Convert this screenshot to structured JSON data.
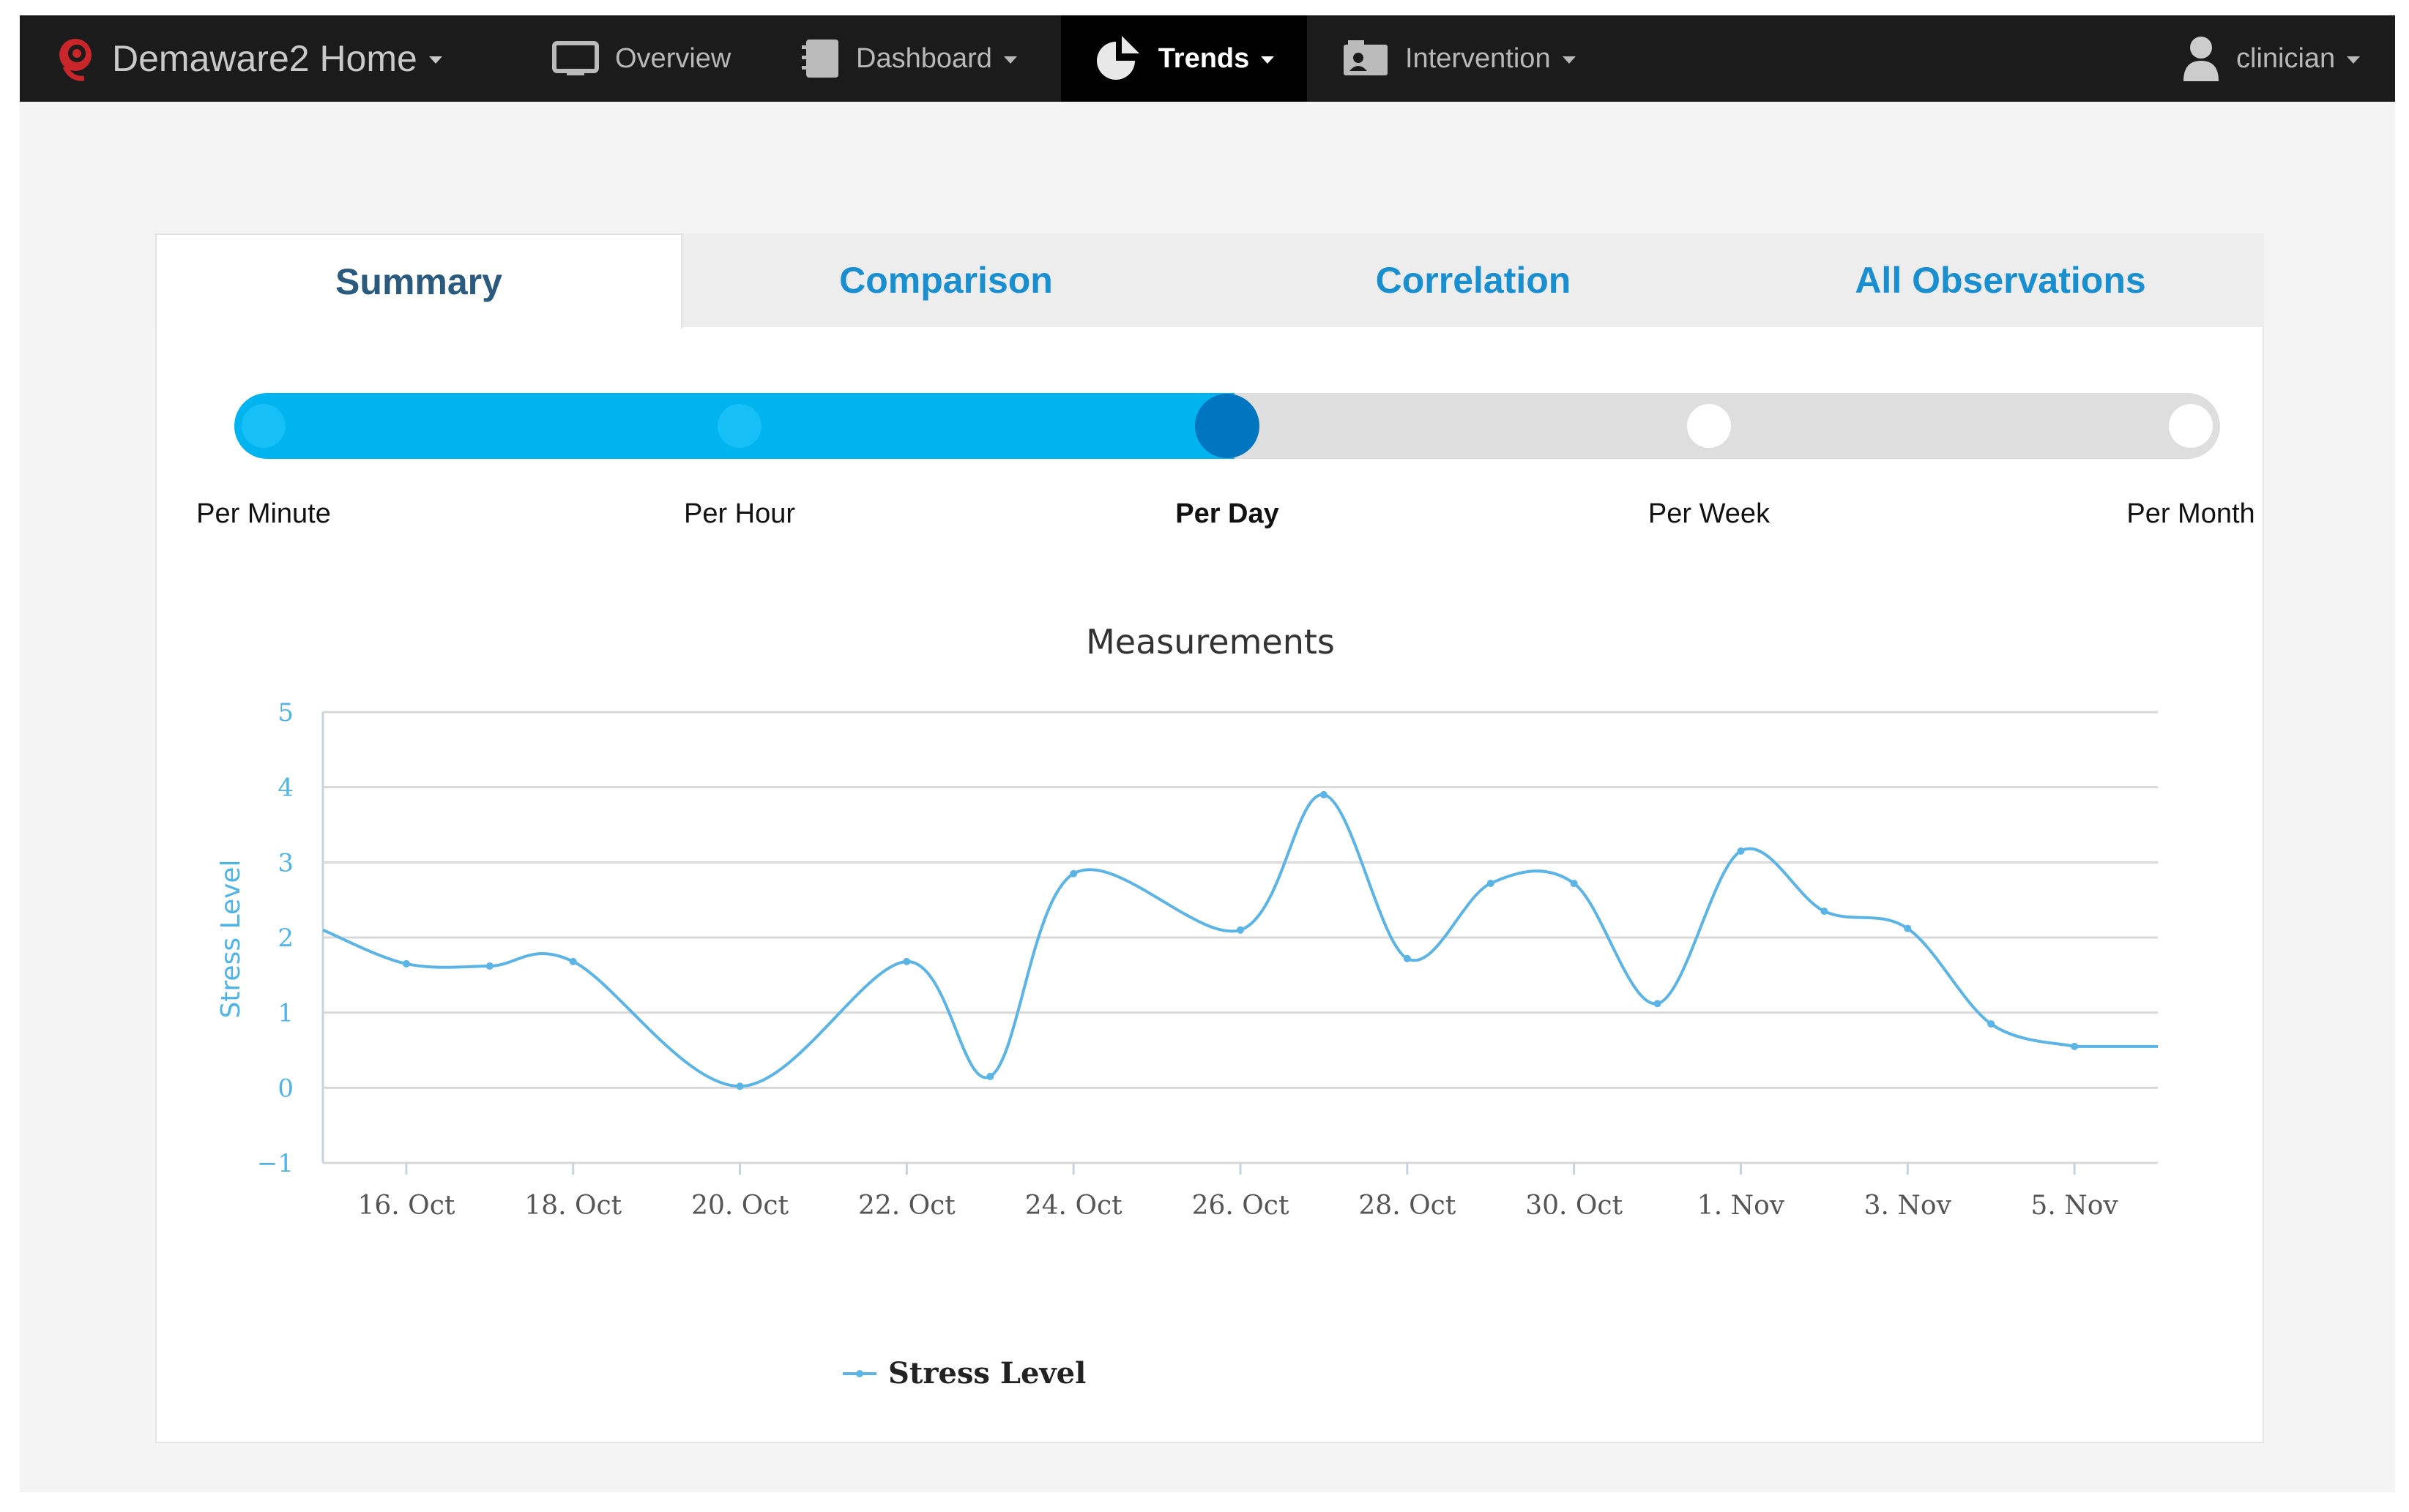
{
  "navbar": {
    "brand": "Demaware2 Home",
    "items": [
      {
        "label": "Overview",
        "icon": "monitor-icon",
        "dropdown": false
      },
      {
        "label": "Dashboard",
        "icon": "notebook-icon",
        "dropdown": true
      },
      {
        "label": "Trends",
        "icon": "pie-chart-icon",
        "dropdown": true,
        "active": true
      },
      {
        "label": "Intervention",
        "icon": "contact-card-icon",
        "dropdown": true
      }
    ],
    "user": "clinician"
  },
  "tabs": [
    {
      "label": "Summary",
      "active": true
    },
    {
      "label": "Comparison"
    },
    {
      "label": "Correlation"
    },
    {
      "label": "All Observations"
    }
  ],
  "granularity": {
    "options": [
      "Per Minute",
      "Per Hour",
      "Per Day",
      "Per Week",
      "Per Month"
    ],
    "selected": "Per Day"
  },
  "colors": {
    "accent": "#00b4f0",
    "selected_stop": "#0075c0",
    "series": "#5ab4e6",
    "tab_link": "#1a8fd0"
  },
  "chart_data": {
    "type": "line",
    "title": "Measurements",
    "xlabel": "",
    "ylabel": "Stress Level",
    "ylim": [
      -1,
      5
    ],
    "yticks": [
      -1,
      0,
      1,
      2,
      3,
      4,
      5
    ],
    "xticks": [
      "16. Oct",
      "18. Oct",
      "20. Oct",
      "22. Oct",
      "24. Oct",
      "26. Oct",
      "28. Oct",
      "30. Oct",
      "1. Nov",
      "3. Nov",
      "5. Nov"
    ],
    "xrange": [
      "2015-10-15",
      "2015-11-06"
    ],
    "grid": true,
    "legend": "bottom",
    "series": [
      {
        "name": "Stress Level",
        "x": [
          "2015-10-15",
          "2015-10-16",
          "2015-10-17",
          "2015-10-18",
          "2015-10-20",
          "2015-10-22",
          "2015-10-23",
          "2015-10-24",
          "2015-10-26",
          "2015-10-27",
          "2015-10-28",
          "2015-10-29",
          "2015-10-30",
          "2015-10-31",
          "2015-11-01",
          "2015-11-02",
          "2015-11-03",
          "2015-11-04",
          "2015-11-05"
        ],
        "values": [
          2.1,
          1.65,
          1.62,
          1.68,
          0.02,
          1.68,
          0.15,
          2.85,
          2.1,
          3.9,
          1.72,
          2.72,
          2.72,
          1.12,
          3.15,
          2.35,
          2.12,
          0.85,
          0.55
        ],
        "extend_to": "2015-11-06"
      }
    ]
  }
}
